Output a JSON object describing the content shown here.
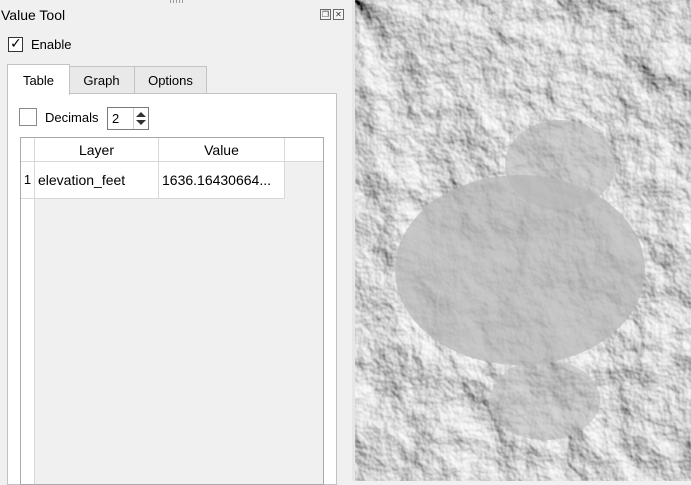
{
  "panel": {
    "title": "Value Tool",
    "enable_label": "Enable",
    "enable_checked": true,
    "float_icon": "restore-icon",
    "close_icon": "close-icon"
  },
  "tabs": [
    {
      "label": "Table",
      "active": true
    },
    {
      "label": "Graph",
      "active": false
    },
    {
      "label": "Options",
      "active": false
    }
  ],
  "table_tab": {
    "decimals_label": "Decimals",
    "decimals_checked": false,
    "decimals_value": "2",
    "columns": [
      "Layer",
      "Value"
    ],
    "rows": [
      {
        "index": "1",
        "layer": "elevation_feet",
        "value": "1636.16430664..."
      }
    ]
  },
  "map": {
    "description_icon": "hillshade-map-canvas"
  }
}
